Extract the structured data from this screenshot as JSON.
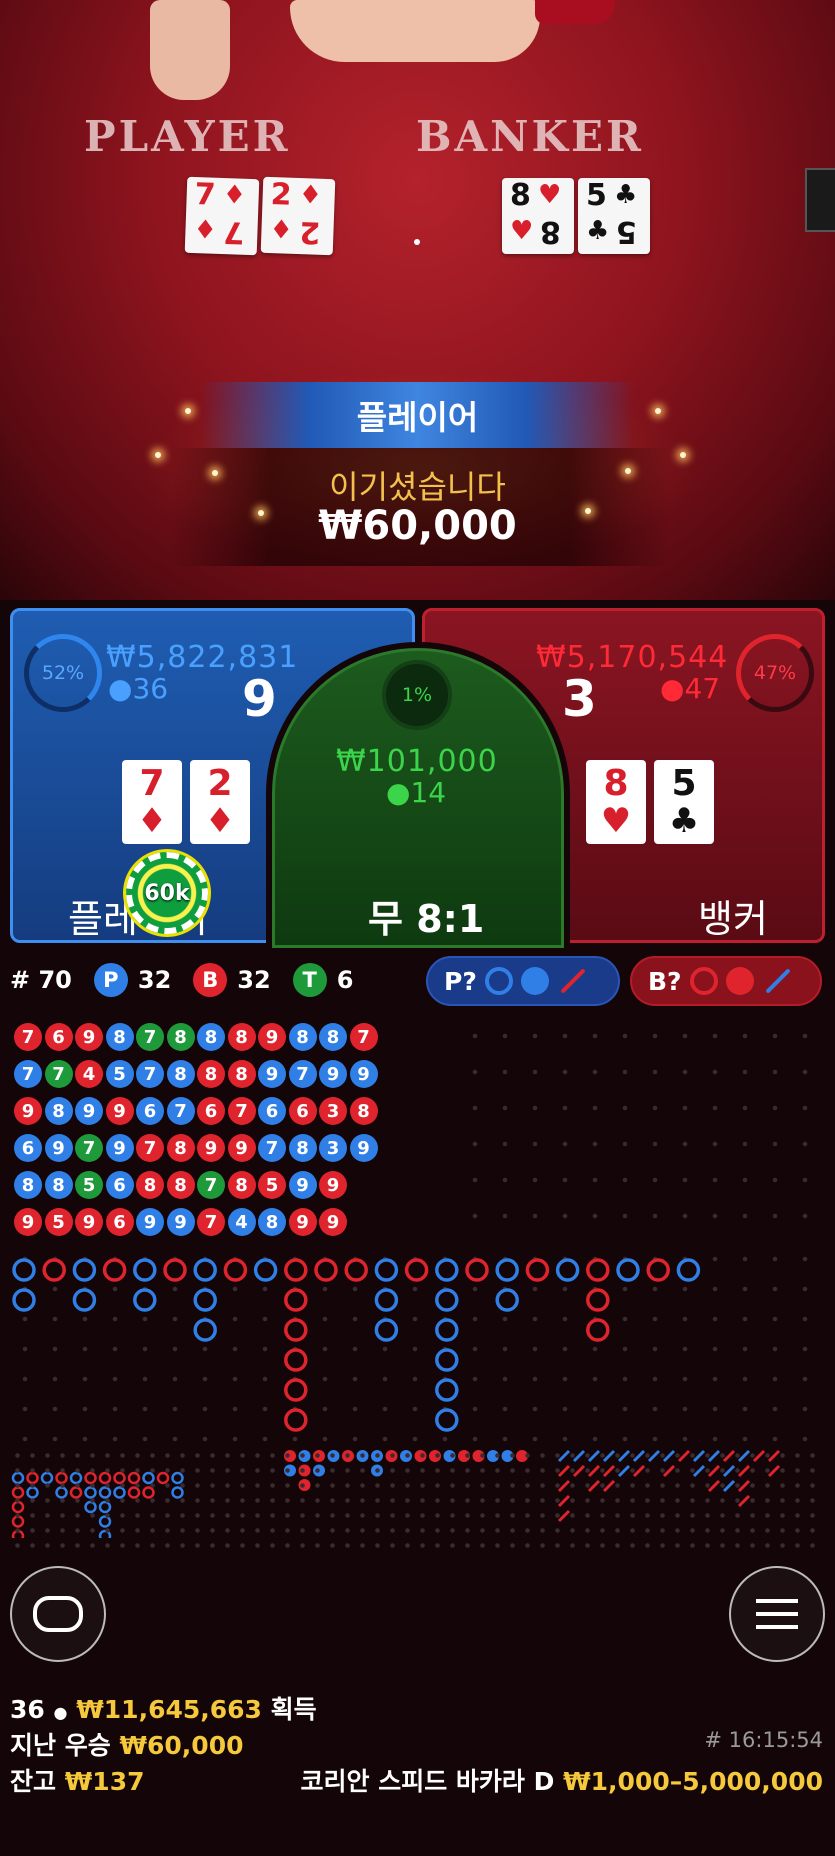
{
  "table": {
    "player_label": "PLAYER",
    "banker_label": "BANKER",
    "player_cards": [
      {
        "rank": "7",
        "suit": "♦"
      },
      {
        "rank": "2",
        "suit": "♦"
      }
    ],
    "banker_cards": [
      {
        "rank": "8",
        "suit": "♥"
      },
      {
        "rank": "5",
        "suit": "♣"
      }
    ]
  },
  "win_banner": {
    "title": "플레이어",
    "subtitle": "이기셨습니다",
    "amount": "₩60,000"
  },
  "bets": {
    "player": {
      "percent": "52%",
      "amount": "₩5,822,831",
      "count": "36",
      "score": "9",
      "label": "플레이어",
      "cards": [
        {
          "rank": "7",
          "suit": "♦",
          "color": "#d8202c"
        },
        {
          "rank": "2",
          "suit": "♦",
          "color": "#d8202c"
        }
      ],
      "chip": "60k"
    },
    "tie": {
      "percent": "1%",
      "amount": "₩101,000",
      "count": "14",
      "label": "무 8:1"
    },
    "banker": {
      "percent": "47%",
      "amount": "₩5,170,544",
      "count": "47",
      "score": "3",
      "label": "뱅커",
      "cards": [
        {
          "rank": "8",
          "suit": "♥",
          "color": "#d8202c"
        },
        {
          "rank": "5",
          "suit": "♣",
          "color": "#111111"
        }
      ]
    }
  },
  "stats": {
    "round": "# 70",
    "p_letter": "P",
    "p_count": "32",
    "b_letter": "B",
    "b_count": "32",
    "t_letter": "T",
    "t_count": "6",
    "p_predict": "P?",
    "b_predict": "B?"
  },
  "bead_road": [
    [
      "7r",
      "7b",
      "9r",
      "6b",
      "8b",
      "9r"
    ],
    [
      "6r",
      "7g",
      "8b",
      "9b",
      "8b",
      "5r"
    ],
    [
      "9r",
      "4r",
      "9b",
      "7g",
      "5g",
      "9r"
    ],
    [
      "8b",
      "5b",
      "9r",
      "9b",
      "6b",
      "6r"
    ],
    [
      "7g",
      "7b",
      "6b",
      "7r",
      "8r",
      "9b"
    ],
    [
      "8g",
      "8b",
      "7b",
      "8r",
      "8r",
      "9b"
    ],
    [
      "8b",
      "8r",
      "6r",
      "9r",
      "7g",
      "7r"
    ],
    [
      "8r",
      "8r",
      "7r",
      "9r",
      "8r",
      "4b"
    ],
    [
      "9r",
      "9b",
      "6b",
      "7b",
      "5r",
      "8b"
    ],
    [
      "8b",
      "7b",
      "6r",
      "8b",
      "9b",
      "9r"
    ],
    [
      "8b",
      "9b",
      "3r",
      "3b",
      "9r",
      "9r"
    ],
    [
      "7r",
      "9b",
      "8r",
      "9b",
      "",
      ""
    ]
  ],
  "colors": {
    "player": "#2f7fe6",
    "banker": "#e0242e",
    "tie": "#1f9a3a",
    "gold": "#f5c93b"
  },
  "footer": {
    "players": "36",
    "total_win": "₩11,645,663",
    "total_win_label": "획득",
    "last_win_label": "지난 우승",
    "last_win": "₩60,000",
    "time": "# 16:15:54",
    "balance_label": "잔고",
    "balance": "₩137",
    "table_name": "코리안 스피드 바카라 D",
    "limits": "₩1,000–5,000,000"
  },
  "icons": {
    "chat": "chat-icon",
    "menu": "menu-icon",
    "person": "person-icon"
  }
}
